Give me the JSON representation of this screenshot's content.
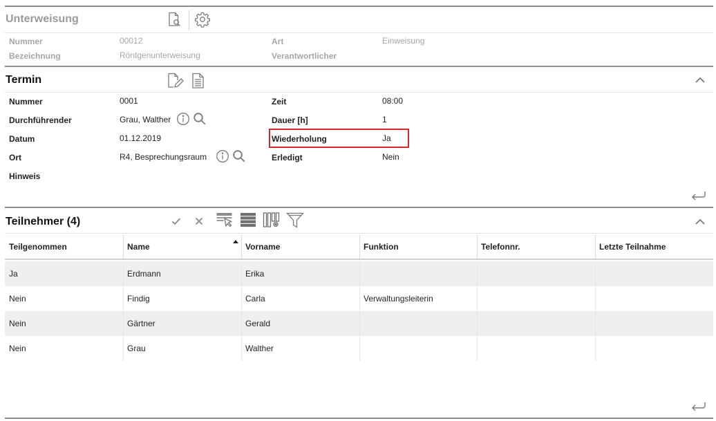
{
  "unterweisung": {
    "title": "Unterweisung",
    "fields": {
      "nummer_label": "Nummer",
      "nummer_value": "00012",
      "bezeichnung_label": "Bezeichnung",
      "bezeichnung_value": "Röntgenunterweisung",
      "art_label": "Art",
      "art_value": "Einweisung",
      "verantwortlicher_label": "Verantwortlicher",
      "verantwortlicher_value": ""
    },
    "icons": [
      "document-search-icon",
      "gear-icon"
    ]
  },
  "termin": {
    "title": "Termin",
    "fields": {
      "nummer_label": "Nummer",
      "nummer_value": "0001",
      "durchfuehrender_label": "Durchführender",
      "durchfuehrender_value": "Grau, Walther",
      "datum_label": "Datum",
      "datum_value": "01.12.2019",
      "ort_label": "Ort",
      "ort_value": "R4, Besprechungsraum",
      "hinweis_label": "Hinweis",
      "hinweis_value": "",
      "zeit_label": "Zeit",
      "zeit_value": "08:00",
      "dauer_label": "Dauer [h]",
      "dauer_value": "1",
      "wiederholung_label": "Wiederholung",
      "wiederholung_value": "Ja",
      "erledigt_label": "Erledigt",
      "erledigt_value": "Nein"
    },
    "icons": [
      "edit-document-icon",
      "document-icon",
      "info-icon",
      "search-icon",
      "chevron-up-icon",
      "return-icon"
    ]
  },
  "teilnehmer": {
    "title": "Teilnehmer (4)",
    "columns": [
      "Teilgenommen",
      "Name",
      "Vorname",
      "Funktion",
      "Telefonnr.",
      "Letzte Teilnahme"
    ],
    "sorted_column": "Name",
    "rows": [
      [
        "Ja",
        "Erdmann",
        "Erika",
        "",
        "",
        ""
      ],
      [
        "Nein",
        "Findig",
        "Carla",
        "Verwaltungsleiterin",
        "",
        ""
      ],
      [
        "Nein",
        "Gärtner",
        "Gerald",
        "",
        "",
        ""
      ],
      [
        "Nein",
        "Grau",
        "Walther",
        "",
        "",
        ""
      ]
    ],
    "toolbar_icons": [
      "check-icon",
      "close-icon",
      "select-rows-icon",
      "rows-icon",
      "column-settings-icon",
      "filter-icon"
    ]
  },
  "colors": {
    "highlight": "#d9262c",
    "border": "#8c8c8c",
    "icon": "#7a7a7a",
    "muted_text": "#a6a6a6",
    "alt_row": "#efefef"
  }
}
